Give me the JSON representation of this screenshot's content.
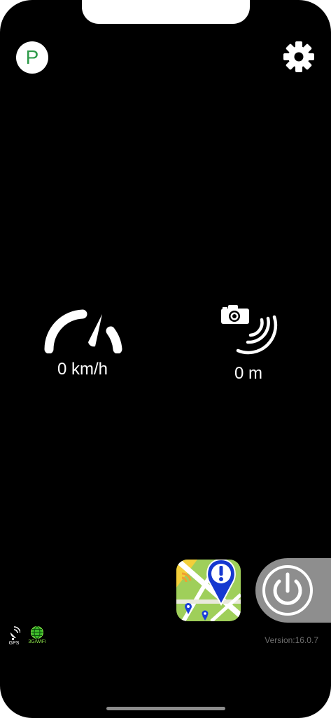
{
  "header": {
    "parking_badge": "P"
  },
  "icons": {
    "settings": "gear-icon",
    "speedometer": "speedometer-icon",
    "camera": "speed-camera-icon",
    "map": "map-report-icon",
    "power": "power-icon",
    "gps": "satellite-icon",
    "network": "globe-icon"
  },
  "readouts": {
    "speed": "0 km/h",
    "distance": "0 m"
  },
  "status": {
    "gps_label": "GPS",
    "network_label": "3G/WiFi"
  },
  "footer": {
    "version": "Version:16.0.7"
  },
  "colors": {
    "background": "#000000",
    "accent_green": "#2e9b4a",
    "network_green": "#8be04a",
    "power_gray": "#8e8e8e"
  }
}
